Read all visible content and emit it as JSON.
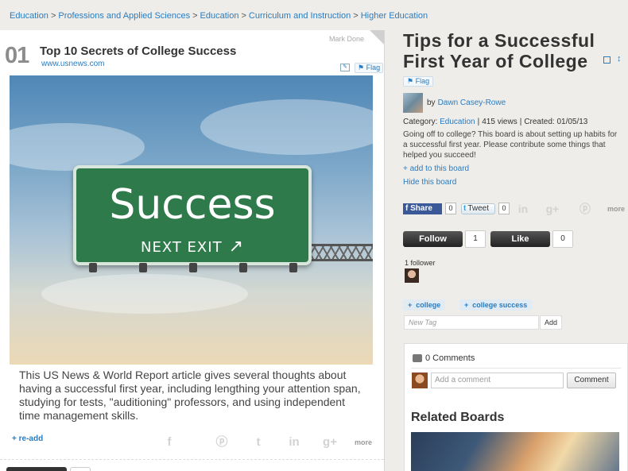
{
  "breadcrumb": {
    "items": [
      "Education",
      "Professions and Applied Sciences",
      "Education",
      "Curriculum and Instruction",
      "Higher Education"
    ],
    "separator": ">"
  },
  "card": {
    "number": "01",
    "title": "Top 10 Secrets of College Success",
    "source": "www.usnews.com",
    "mark_done": "Mark Done",
    "flag": "Flag",
    "image": {
      "sign_text": "Success",
      "sign_subtext": "NEXT EXIT",
      "arrow": "↗"
    },
    "description": "This US News & World Report article gives several thoughts about having a successful first year, including lengthing your attention span, studying for tests, \"auditioning\" professors, and using independent time management skills.",
    "readd": "+ re-add",
    "share_icons": [
      "facebook-icon",
      "pinterest-icon",
      "twitter-icon",
      "linkedin-icon",
      "googleplus-icon"
    ],
    "more": "more"
  },
  "board": {
    "title": "Tips for a Successful First Year of College",
    "flag": "Flag",
    "by_label": "by",
    "creator": "Dawn Casey-Rowe",
    "category_label": "Category:",
    "category": "Education",
    "views": "415 views",
    "created": "Created: 01/05/13",
    "description": "Going off to college? This board is about setting up habits for a successful first year. Please contribute some things that helped you succeed!",
    "add_to_board": "+ add to this board",
    "hide_board": "Hide this board"
  },
  "social": {
    "fb_share": "Share",
    "fb_count": "0",
    "tweet": "Tweet",
    "tweet_count": "0",
    "more": "more",
    "icons": [
      "linkedin-icon",
      "googleplus-icon",
      "pinterest-icon"
    ]
  },
  "actions": {
    "follow": "Follow",
    "follow_count": "1",
    "like": "Like",
    "like_count": "0"
  },
  "followers": {
    "label": "1 follower"
  },
  "tags": {
    "items": [
      "college",
      "college success"
    ],
    "new_tag_placeholder": "New Tag",
    "add_button": "Add"
  },
  "comments": {
    "count_label": "0 Comments",
    "placeholder": "Add a comment",
    "button": "Comment",
    "related_title": "Related Boards"
  }
}
